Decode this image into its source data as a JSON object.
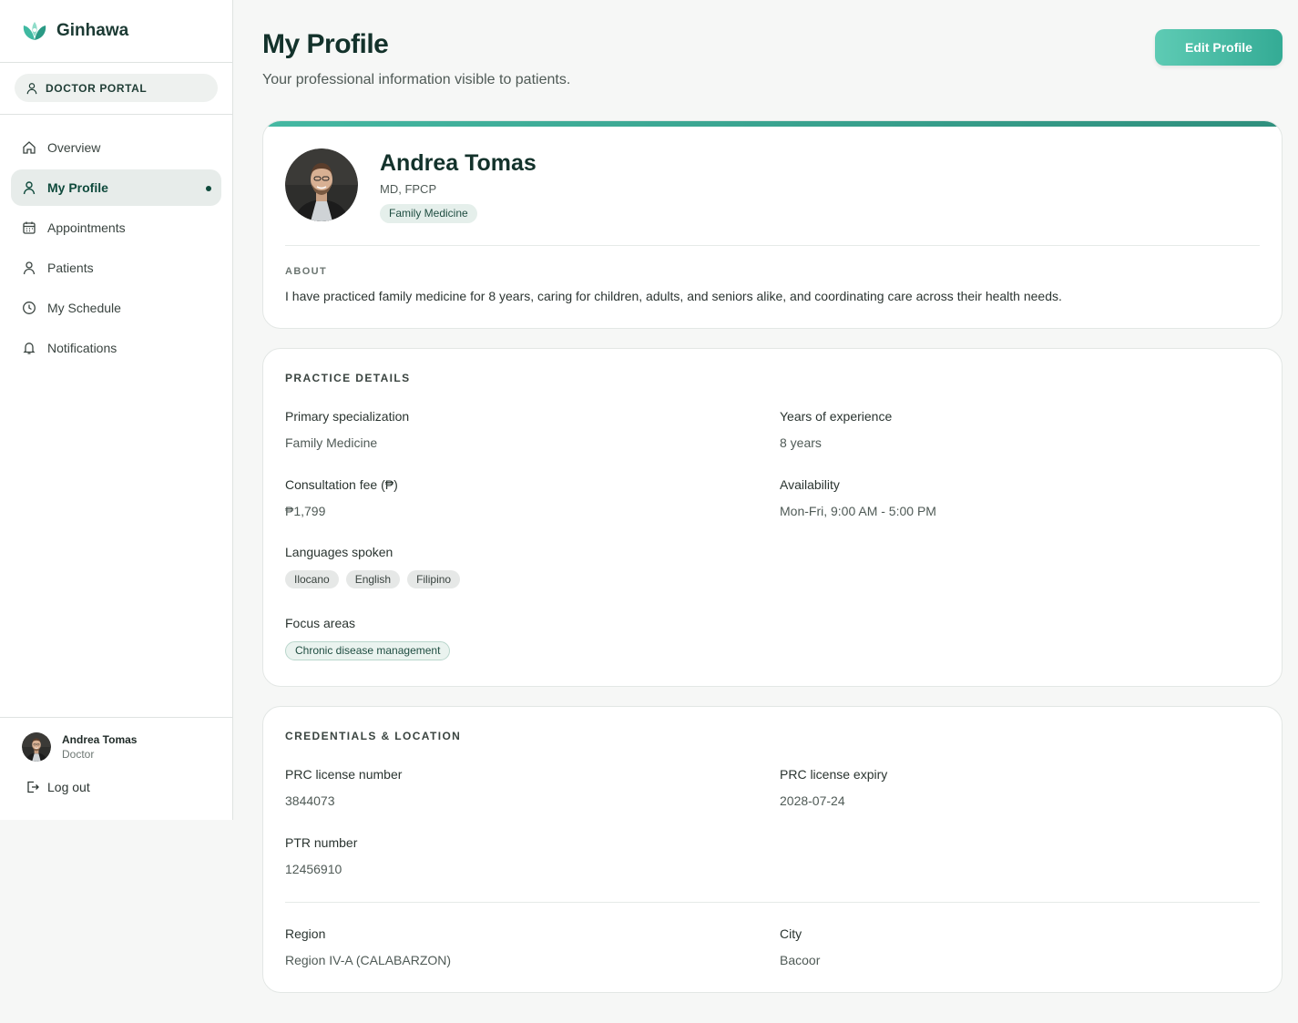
{
  "app": {
    "name": "Ginhawa",
    "portal_label": "DOCTOR PORTAL"
  },
  "nav": {
    "items": [
      {
        "label": "Overview",
        "icon": "home-icon"
      },
      {
        "label": "My Profile",
        "icon": "user-icon",
        "active": true
      },
      {
        "label": "Appointments",
        "icon": "calendar-icon"
      },
      {
        "label": "Patients",
        "icon": "user-icon"
      },
      {
        "label": "My Schedule",
        "icon": "clock-icon"
      },
      {
        "label": "Notifications",
        "icon": "bell-icon"
      }
    ]
  },
  "user": {
    "name": "Andrea Tomas",
    "role": "Doctor",
    "logout_label": "Log out"
  },
  "page": {
    "title": "My Profile",
    "subtitle": "Your professional information visible to patients.",
    "edit_button": "Edit Profile"
  },
  "profile": {
    "name": "Andrea Tomas",
    "credentials": "MD, FPCP",
    "specialty_chip": "Family Medicine",
    "about_label": "ABOUT",
    "about_text": "I have practiced family medicine for 8 years, caring for children, adults, and seniors alike, and coordinating care across their health needs."
  },
  "practice": {
    "section_title": "PRACTICE DETAILS",
    "primary_specialization_label": "Primary specialization",
    "primary_specialization": "Family Medicine",
    "years_label": "Years of experience",
    "years": "8 years",
    "fee_label": "Consultation fee (₱)",
    "fee": "₱1,799",
    "availability_label": "Availability",
    "availability": "Mon-Fri, 9:00 AM - 5:00 PM",
    "languages_label": "Languages spoken",
    "languages": [
      "Ilocano",
      "English",
      "Filipino"
    ],
    "focus_label": "Focus areas",
    "focus_areas": [
      "Chronic disease management"
    ]
  },
  "credentials": {
    "section_title": "CREDENTIALS & LOCATION",
    "prc_label": "PRC license number",
    "prc": "3844073",
    "prc_expiry_label": "PRC license expiry",
    "prc_expiry": "2028-07-24",
    "ptr_label": "PTR number",
    "ptr": "12456910",
    "region_label": "Region",
    "region": "Region IV-A (CALABARZON)",
    "city_label": "City",
    "city": "Bacoor"
  },
  "colors": {
    "brand": "#0f4a3c",
    "accent": "#3fb9a1",
    "page_bg": "#f6f7f6"
  }
}
